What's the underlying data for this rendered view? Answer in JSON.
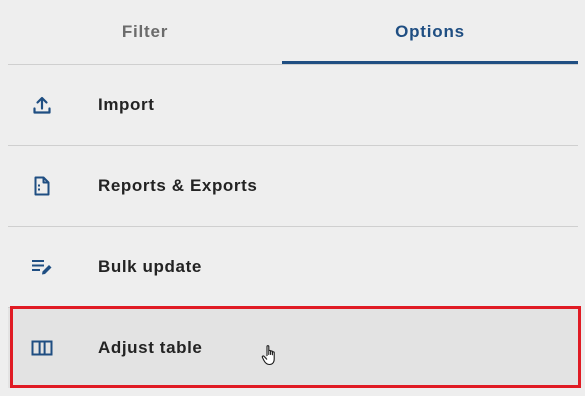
{
  "tabs": [
    {
      "label": "Filter",
      "active": false
    },
    {
      "label": "Options",
      "active": true
    }
  ],
  "menu": [
    {
      "label": "Import",
      "icon": "upload-icon"
    },
    {
      "label": "Reports & Exports",
      "icon": "document-icon"
    },
    {
      "label": "Bulk update",
      "icon": "edit-list-icon"
    },
    {
      "label": "Adjust table",
      "icon": "table-columns-icon",
      "highlighted": true
    }
  ],
  "colors": {
    "accent": "#1f4e82",
    "background": "#eeeeee",
    "highlight_border": "#e01b24",
    "divider": "#cfcfcf",
    "text": "#232323",
    "inactive_tab_text": "#6b6b6b"
  }
}
